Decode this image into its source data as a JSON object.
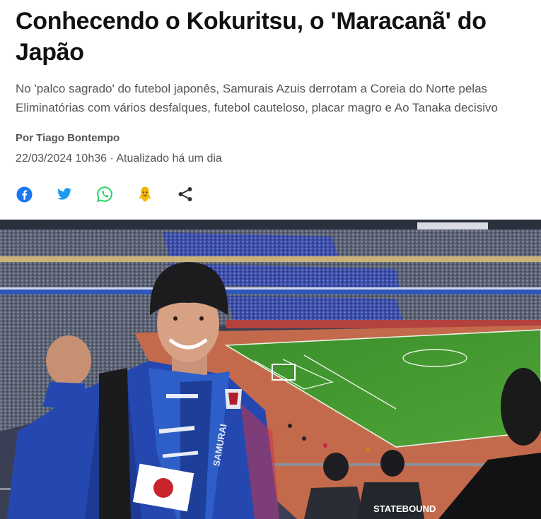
{
  "article": {
    "title": "Conhecendo o Kokuritsu, o 'Maracanã' do Japão",
    "subtitle": "No 'palco sagrado' do futebol japonês, Samurais Azuis derrotam a Coreia do Norte pelas Eliminatórias com vários desfalques, futebol cauteloso, placar magro e Ao Tanaka decisivo",
    "author": "Por Tiago Bontempo",
    "date": "22/03/2024 10h36",
    "separator": " · ",
    "updated": "Atualizado há um dia"
  },
  "share": {
    "buttons": [
      {
        "network": "facebook",
        "icon": "facebook-icon",
        "color": "#1877f2"
      },
      {
        "network": "twitter",
        "icon": "twitter-icon",
        "color": "#1d9bf0"
      },
      {
        "network": "whatsapp",
        "icon": "whatsapp-icon",
        "color": "#25d366"
      },
      {
        "network": "kwai",
        "icon": "kwai-icon",
        "color": "#f2b705"
      },
      {
        "network": "share",
        "icon": "share-icon",
        "color": "#333333"
      }
    ]
  },
  "photo": {
    "scarf_text": "SAMURAI",
    "shirt_text": "STATEBOUND"
  }
}
